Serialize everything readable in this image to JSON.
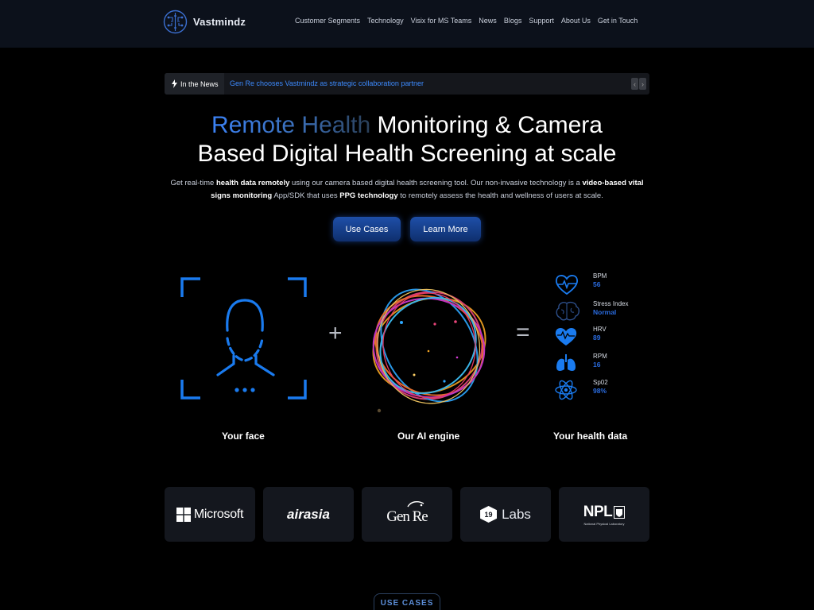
{
  "brand": {
    "name": "Vastmindz"
  },
  "nav": {
    "links": [
      "Customer Segments",
      "Technology",
      "Visix for MS Teams",
      "News",
      "Blogs",
      "Support",
      "About Us",
      "Get in Touch"
    ]
  },
  "news": {
    "label": "In the News",
    "headline": "Gen Re chooses Vastmindz as strategic collaboration partner"
  },
  "hero": {
    "title_highlight": "Remote Health",
    "title_rest": " Monitoring & Camera",
    "title_line2": "Based Digital Health Screening at scale",
    "sub_1": "Get real-time ",
    "sub_2": "health data remotely",
    "sub_3": " using our camera based digital health screening tool. Our non-invasive technology is a ",
    "sub_4": "video-based vital signs monitoring",
    "sub_5": " App/SDK that uses ",
    "sub_6": "PPG technology",
    "sub_7": " to remotely assess the health and wellness of users at scale.",
    "btn_use_cases": "Use Cases",
    "btn_learn_more": "Learn More"
  },
  "illustration": {
    "plus": "+",
    "equals": "=",
    "caption_face": "Your face",
    "caption_engine": "Our AI engine",
    "caption_data": "Your health data"
  },
  "metrics": [
    {
      "label": "BPM",
      "value": "56",
      "icon": "heart-pulse-icon"
    },
    {
      "label": "Stress Index",
      "value": "Normal",
      "icon": "brain-icon"
    },
    {
      "label": "HRV",
      "value": "89",
      "icon": "heart-wave-icon"
    },
    {
      "label": "RPM",
      "value": "16",
      "icon": "lungs-icon"
    },
    {
      "label": "Sp02",
      "value": "98%",
      "icon": "atom-icon"
    }
  ],
  "logos": {
    "microsoft": "Microsoft",
    "airasia": "airasia",
    "genre": "Gen Re",
    "labs_num": "19",
    "labs": "Labs",
    "npl": "NPL",
    "npl_sub": "National Physical Laboratory"
  },
  "section": {
    "use_cases_label": "USE CASES"
  },
  "colors": {
    "accent": "#3b82f6",
    "nav_bg": "#0c111b",
    "card_bg": "#14171e",
    "metric_value": "#2a6ce0"
  }
}
